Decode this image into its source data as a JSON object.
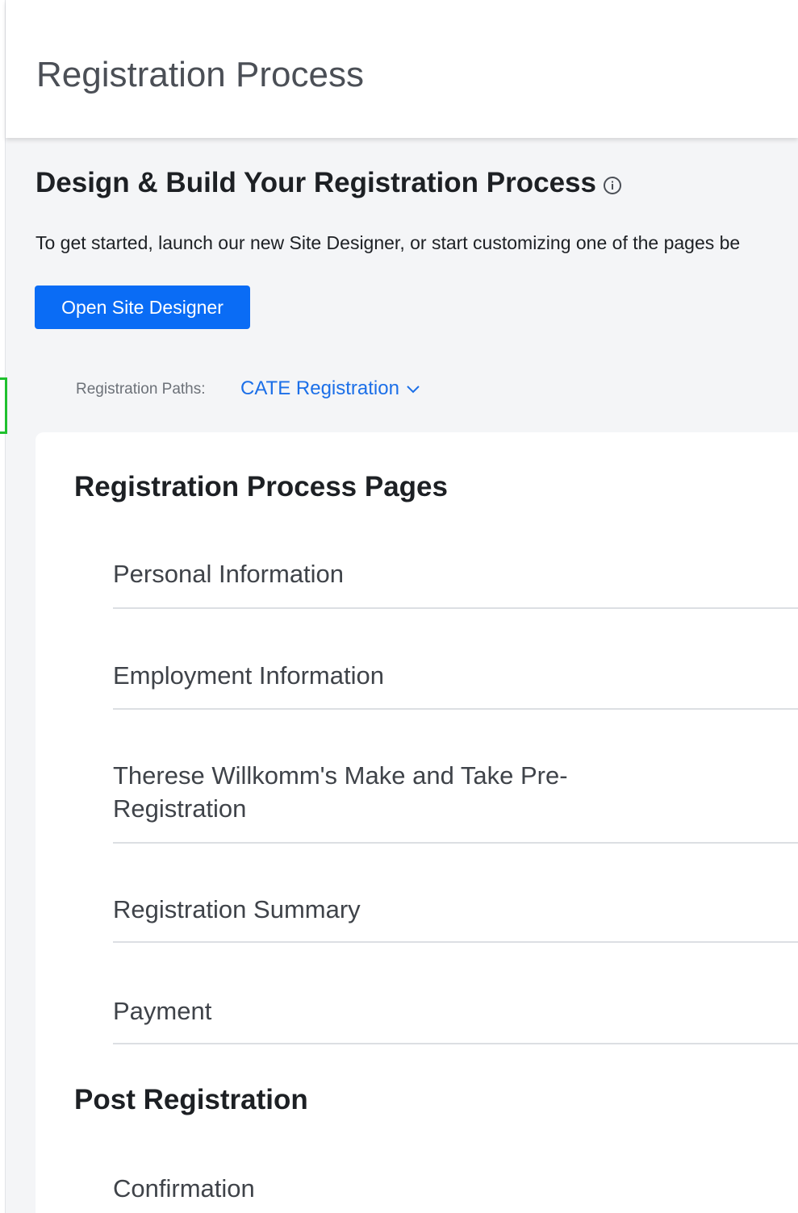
{
  "header": {
    "title": "Registration Process"
  },
  "design": {
    "title": "Design & Build Your Registration Process",
    "info_icon": "info-circle-icon",
    "intro": "To get started, launch our new Site Designer, or start customizing one of the pages be",
    "open_site_designer_label": "Open Site Designer",
    "button_color": "#0a6cf5"
  },
  "registration_paths": {
    "label": "Registration Paths:",
    "selected": "CATE Registration",
    "icon": "chevron-down-icon",
    "link_color": "#1b6fe8"
  },
  "pages": {
    "title": "Registration Process Pages",
    "items": [
      {
        "label": "Personal Information"
      },
      {
        "label": "Employment Information"
      },
      {
        "label": "Therese Willkomm's Make and Take Pre-Registration"
      },
      {
        "label": "Registration Summary"
      },
      {
        "label": "Payment"
      }
    ]
  },
  "post_registration": {
    "title": "Post Registration",
    "items": [
      {
        "label": "Confirmation"
      }
    ]
  }
}
